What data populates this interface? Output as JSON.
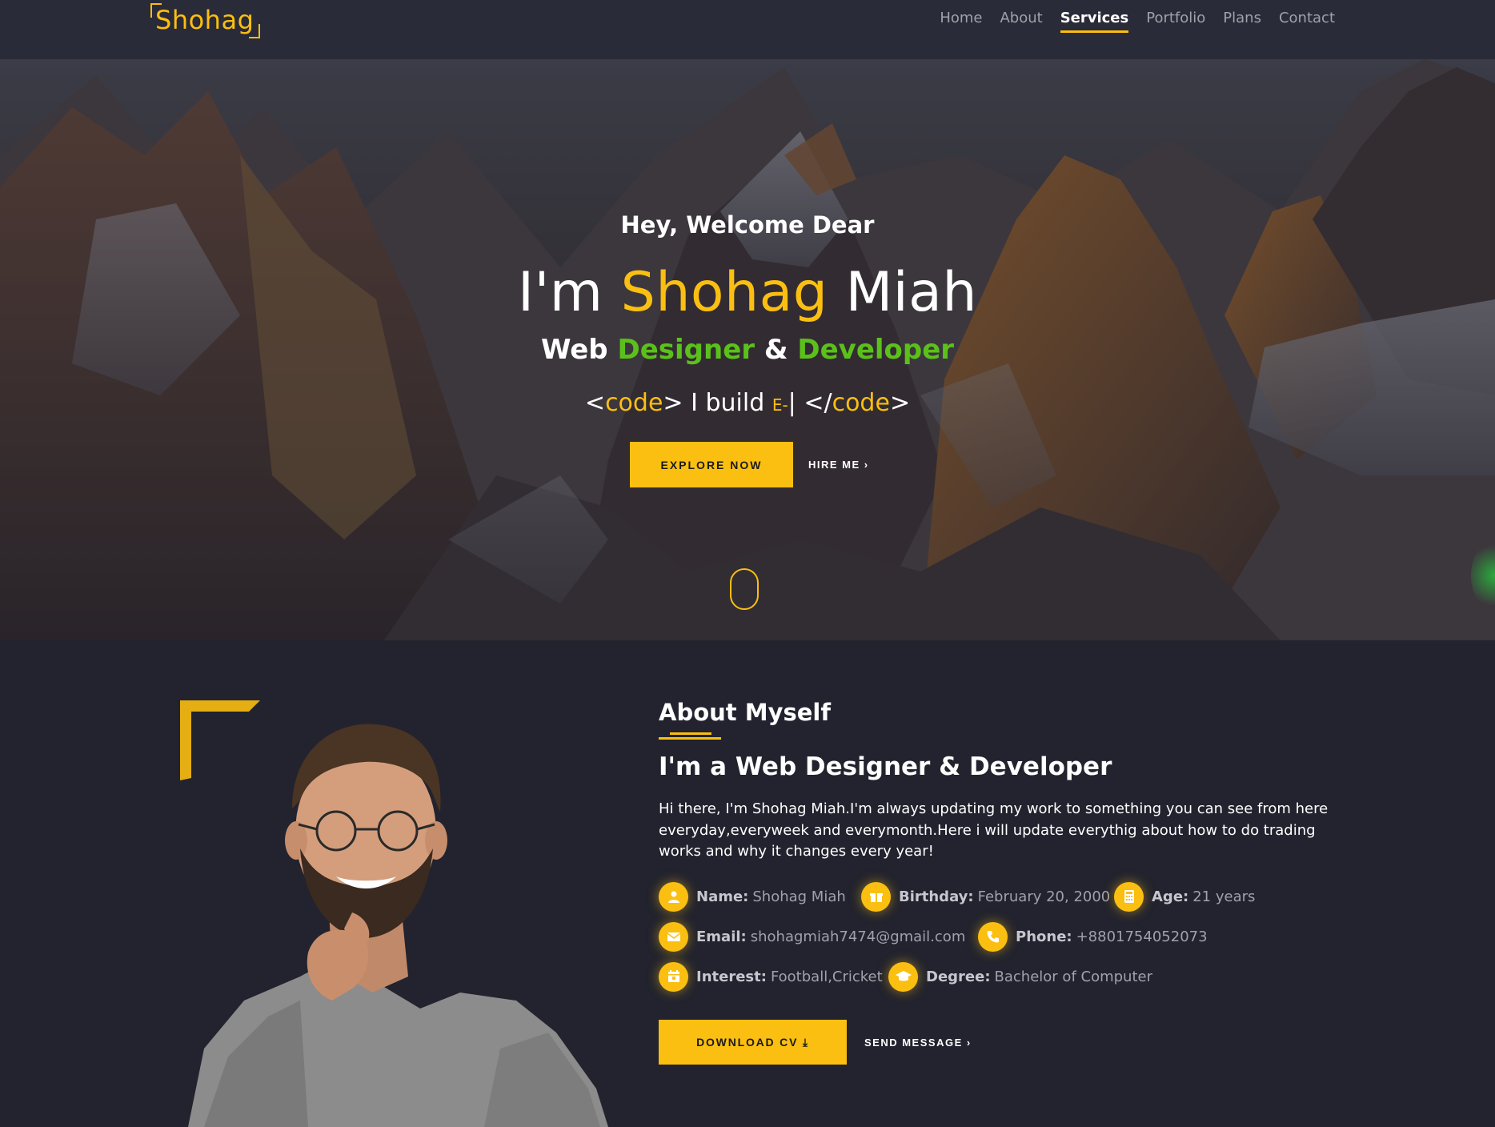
{
  "colors": {
    "accent": "#fbbf11",
    "green": "#5bc11a",
    "nav_bg": "#2a2b38",
    "section_bg": "#22232e"
  },
  "brand": {
    "logo": "Shohag"
  },
  "nav": {
    "items": [
      {
        "label": "Home",
        "active": false
      },
      {
        "label": "About",
        "active": false
      },
      {
        "label": "Services",
        "active": true
      },
      {
        "label": "Portfolio",
        "active": false
      },
      {
        "label": "Plans",
        "active": false
      },
      {
        "label": "Contact",
        "active": false
      }
    ]
  },
  "hero": {
    "greeting": "Hey, Welcome Dear",
    "intro": "I'm",
    "first_name": "Shohag",
    "last_name": "Miah",
    "role_prefix": "Web",
    "role_1": "Designer",
    "role_amp": "&",
    "role_2": "Developer",
    "code_open_bracket": "<",
    "code_word_1": "code",
    "code_close_bracket_1": ">",
    "typed_text": "I build",
    "typed_partial": "E-",
    "cursor": "|",
    "code_close_open": "</",
    "code_word_2": "code",
    "code_close_bracket_2": ">",
    "explore_button": "EXPLORE NOW",
    "hire_button": "HIRE ME",
    "scroll_icon": "mouse-scroll-icon"
  },
  "about": {
    "title": "About Myself",
    "subtitle": "I'm a Web Designer & Developer",
    "description": "Hi there, I'm Shohag Miah.I'm always updating my work to something you can see from here everyday,everyweek and everymonth.Here i will update everythig about how to do trading works and why it changes every year!",
    "info": {
      "name": {
        "label": "Name:",
        "value": "Shohag Miah",
        "icon": "user-icon"
      },
      "birthday": {
        "label": "Birthday:",
        "value": "February 20, 2000",
        "icon": "gift-icon"
      },
      "age": {
        "label": "Age:",
        "value": "21 years",
        "icon": "calculator-icon"
      },
      "email": {
        "label": "Email:",
        "value": "shohagmiah7474@gmail.com",
        "icon": "envelope-icon"
      },
      "phone": {
        "label": "Phone:",
        "value": "+8801754052073",
        "icon": "phone-icon"
      },
      "interest": {
        "label": "Interest:",
        "value": "Football,Cricket",
        "icon": "calendar-icon"
      },
      "degree": {
        "label": "Degree:",
        "value": "Bachelor of Computer",
        "icon": "graduation-cap-icon"
      }
    },
    "download_button": "DOWNLOAD CV",
    "send_button": "SEND MESSAGE"
  }
}
